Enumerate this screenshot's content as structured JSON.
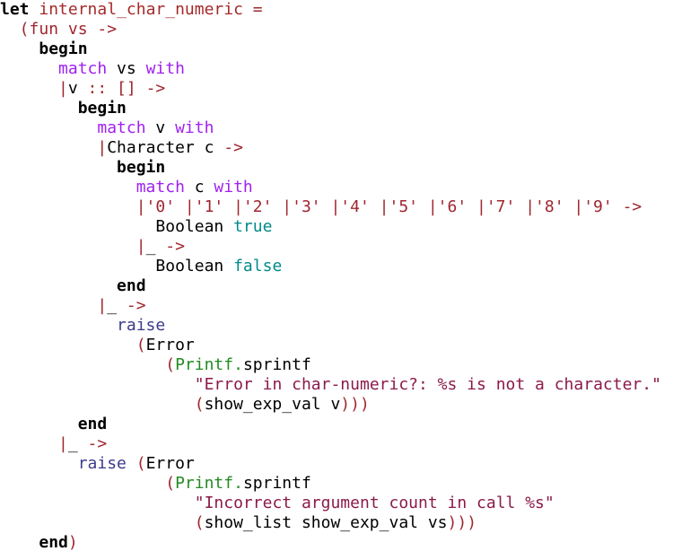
{
  "editor": {
    "lines": [
      {
        "segments": [
          {
            "text": "let",
            "cls": "kw"
          },
          {
            "text": " ",
            "cls": "plain"
          },
          {
            "text": "internal_char_numeric",
            "cls": "id"
          },
          {
            "text": " =",
            "cls": "br"
          }
        ]
      },
      {
        "segments": [
          {
            "text": "  (",
            "cls": "br"
          },
          {
            "text": "fun",
            "cls": "br"
          },
          {
            "text": " vs ",
            "cls": "br"
          },
          {
            "text": "->",
            "cls": "br"
          }
        ]
      },
      {
        "segments": [
          {
            "text": "    ",
            "cls": "plain"
          },
          {
            "text": "begin",
            "cls": "kw"
          }
        ]
      },
      {
        "segments": [
          {
            "text": "      ",
            "cls": "plain"
          },
          {
            "text": "match",
            "cls": "mt"
          },
          {
            "text": " vs ",
            "cls": "plain"
          },
          {
            "text": "with",
            "cls": "mt"
          }
        ]
      },
      {
        "segments": [
          {
            "text": "      |",
            "cls": "br"
          },
          {
            "text": "v ",
            "cls": "plain"
          },
          {
            "text": ":: [] ->",
            "cls": "br"
          }
        ]
      },
      {
        "segments": [
          {
            "text": "        ",
            "cls": "plain"
          },
          {
            "text": "begin",
            "cls": "kw"
          }
        ]
      },
      {
        "segments": [
          {
            "text": "          ",
            "cls": "plain"
          },
          {
            "text": "match",
            "cls": "mt"
          },
          {
            "text": " v ",
            "cls": "plain"
          },
          {
            "text": "with",
            "cls": "mt"
          }
        ]
      },
      {
        "segments": [
          {
            "text": "          |",
            "cls": "br"
          },
          {
            "text": "Character c ",
            "cls": "plain"
          },
          {
            "text": "->",
            "cls": "br"
          }
        ]
      },
      {
        "segments": [
          {
            "text": "            ",
            "cls": "plain"
          },
          {
            "text": "begin",
            "cls": "kw"
          }
        ]
      },
      {
        "segments": [
          {
            "text": "              ",
            "cls": "plain"
          },
          {
            "text": "match",
            "cls": "mt"
          },
          {
            "text": " c ",
            "cls": "plain"
          },
          {
            "text": "with",
            "cls": "mt"
          }
        ]
      },
      {
        "segments": [
          {
            "text": "              |'0' |'1' |'2' |'3' |'4' |'5' |'6' |'7' |'8' |'9' ->",
            "cls": "br"
          }
        ]
      },
      {
        "segments": [
          {
            "text": "                Boolean ",
            "cls": "plain"
          },
          {
            "text": "true",
            "cls": "bool"
          }
        ]
      },
      {
        "segments": [
          {
            "text": "              |",
            "cls": "br"
          },
          {
            "text": "_ ",
            "cls": "plain"
          },
          {
            "text": "->",
            "cls": "br"
          }
        ]
      },
      {
        "segments": [
          {
            "text": "                Boolean ",
            "cls": "plain"
          },
          {
            "text": "false",
            "cls": "bool"
          }
        ]
      },
      {
        "segments": [
          {
            "text": "            ",
            "cls": "plain"
          },
          {
            "text": "end",
            "cls": "kw"
          }
        ]
      },
      {
        "segments": [
          {
            "text": "          |",
            "cls": "br"
          },
          {
            "text": "_ ",
            "cls": "plain"
          },
          {
            "text": "->",
            "cls": "br"
          }
        ]
      },
      {
        "segments": [
          {
            "text": "            ",
            "cls": "plain"
          },
          {
            "text": "raise",
            "cls": "raise"
          }
        ]
      },
      {
        "segments": [
          {
            "text": "              (",
            "cls": "br"
          },
          {
            "text": "Error",
            "cls": "plain"
          }
        ]
      },
      {
        "segments": [
          {
            "text": "                 (",
            "cls": "br"
          },
          {
            "text": "Printf.",
            "cls": "mod"
          },
          {
            "text": "sprintf",
            "cls": "plain"
          }
        ]
      },
      {
        "segments": [
          {
            "text": "                    ",
            "cls": "plain"
          },
          {
            "text": "\"Error in char-numeric?: %s is not a character.\"",
            "cls": "str"
          }
        ]
      },
      {
        "segments": [
          {
            "text": "                    (",
            "cls": "br"
          },
          {
            "text": "show_exp_val v",
            "cls": "plain"
          },
          {
            "text": ")))",
            "cls": "br"
          }
        ]
      },
      {
        "segments": [
          {
            "text": "        ",
            "cls": "plain"
          },
          {
            "text": "end",
            "cls": "kw"
          }
        ]
      },
      {
        "segments": [
          {
            "text": "      |",
            "cls": "br"
          },
          {
            "text": "_ ",
            "cls": "plain"
          },
          {
            "text": "->",
            "cls": "br"
          }
        ]
      },
      {
        "segments": [
          {
            "text": "        ",
            "cls": "plain"
          },
          {
            "text": "raise",
            "cls": "raise"
          },
          {
            "text": " (",
            "cls": "br"
          },
          {
            "text": "Error",
            "cls": "plain"
          }
        ]
      },
      {
        "segments": [
          {
            "text": "                 (",
            "cls": "br"
          },
          {
            "text": "Printf.",
            "cls": "mod"
          },
          {
            "text": "sprintf",
            "cls": "plain"
          }
        ]
      },
      {
        "segments": [
          {
            "text": "                    ",
            "cls": "plain"
          },
          {
            "text": "\"Incorrect argument count in call %s\"",
            "cls": "str"
          }
        ]
      },
      {
        "segments": [
          {
            "text": "                    (",
            "cls": "br"
          },
          {
            "text": "show_list show_exp_val vs",
            "cls": "plain"
          },
          {
            "text": ")))",
            "cls": "br"
          }
        ]
      },
      {
        "segments": [
          {
            "text": "    ",
            "cls": "plain"
          },
          {
            "text": "end",
            "cls": "kw"
          },
          {
            "text": ")",
            "cls": "br"
          }
        ]
      }
    ]
  }
}
